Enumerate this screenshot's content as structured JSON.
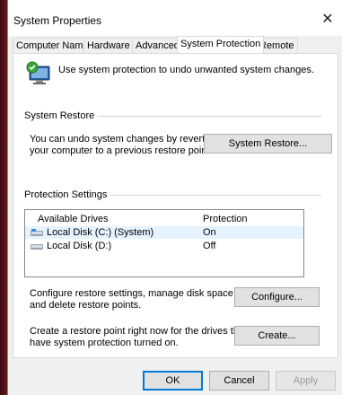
{
  "window": {
    "title": "System Properties",
    "close_glyph": "✕"
  },
  "tabs": [
    {
      "label": "Computer Name",
      "active": false
    },
    {
      "label": "Hardware",
      "active": false
    },
    {
      "label": "Advanced",
      "active": false
    },
    {
      "label": "System Protection",
      "active": true
    },
    {
      "label": "Remote",
      "active": false
    }
  ],
  "intro": {
    "text": "Use system protection to undo unwanted system changes.",
    "icon": "system-protection-icon"
  },
  "system_restore": {
    "group_label": "System Restore",
    "line1": "You can undo system changes by reverting",
    "line2": "your computer to a previous restore point.",
    "button": "System Restore..."
  },
  "protection": {
    "group_label": "Protection Settings",
    "columns": [
      "Available Drives",
      "Protection"
    ],
    "drives": [
      {
        "name": "Local Disk (C:) (System)",
        "protection": "On",
        "icon": "system-drive-icon",
        "selected": true
      },
      {
        "name": "Local Disk (D:)",
        "protection": "Off",
        "icon": "drive-icon",
        "selected": false
      }
    ],
    "configure_line1": "Configure restore settings, manage disk space,",
    "configure_line2": "and delete restore points.",
    "configure_button": "Configure...",
    "create_line1": "Create a restore point right now for the drives that",
    "create_line2": "have system protection turned on.",
    "create_button": "Create..."
  },
  "footer": {
    "ok": "OK",
    "cancel": "Cancel",
    "apply": "Apply"
  },
  "colors": {
    "accent": "#0078d7",
    "selection": "#e5f3ff"
  }
}
